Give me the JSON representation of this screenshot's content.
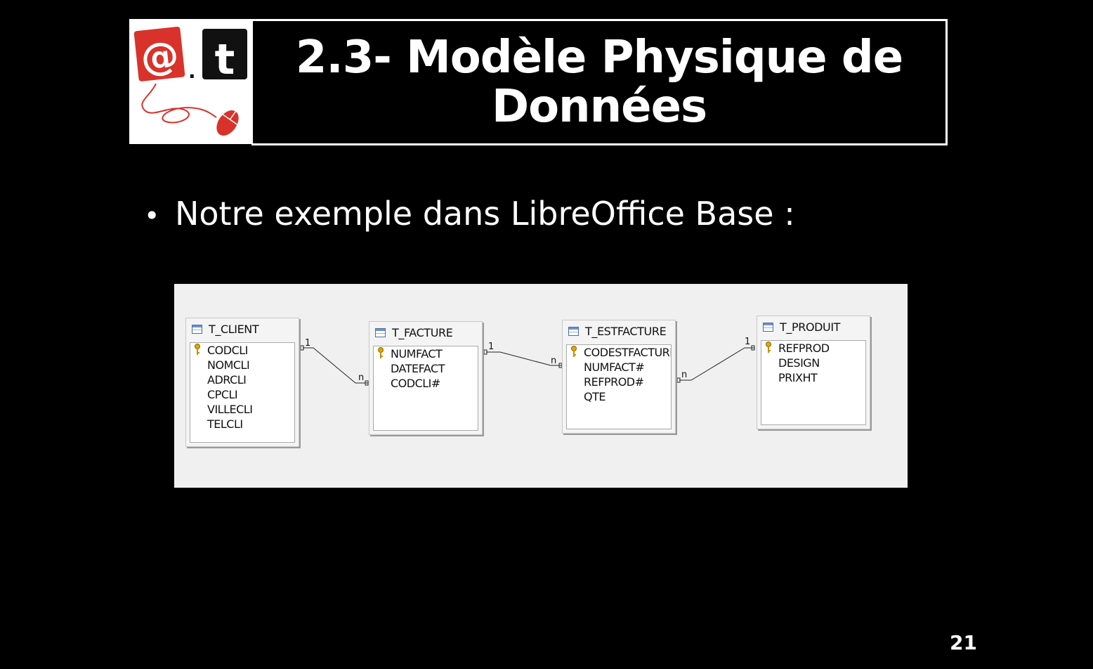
{
  "slide": {
    "title": "2.3- Modèle Physique de Données",
    "bullet": "Notre exemple dans LibreOffice Base :",
    "page_number": "21"
  },
  "logo": {
    "at_symbol": "@",
    "dot": ".",
    "letter": "t",
    "accent_color": "#d9322b"
  },
  "diagram": {
    "tables": [
      {
        "name": "T_CLIENT",
        "fields": [
          "CODCLI",
          "NOMCLI",
          "ADRCLI",
          "CPCLI",
          "VILLECLI",
          "TELCLI"
        ],
        "key": "CODCLI"
      },
      {
        "name": "T_FACTURE",
        "fields": [
          "NUMFACT",
          "DATEFACT",
          "CODCLI#"
        ],
        "key": "NUMFACT"
      },
      {
        "name": "T_ESTFACTURE",
        "fields": [
          "CODESTFACTURE",
          "NUMFACT#",
          "REFPROD#",
          "QTE"
        ],
        "key": "CODESTFACTURE"
      },
      {
        "name": "T_PRODUIT",
        "fields": [
          "REFPROD",
          "DESIGN",
          "PRIXHT"
        ],
        "key": "REFPROD"
      }
    ],
    "relations": [
      {
        "from": "T_CLIENT",
        "to": "T_FACTURE",
        "from_card": "1",
        "to_card": "n"
      },
      {
        "from": "T_FACTURE",
        "to": "T_ESTFACTURE",
        "from_card": "1",
        "to_card": "n"
      },
      {
        "from": "T_ESTFACTURE",
        "to": "T_PRODUIT",
        "from_card": "n",
        "to_card": "1"
      }
    ]
  }
}
